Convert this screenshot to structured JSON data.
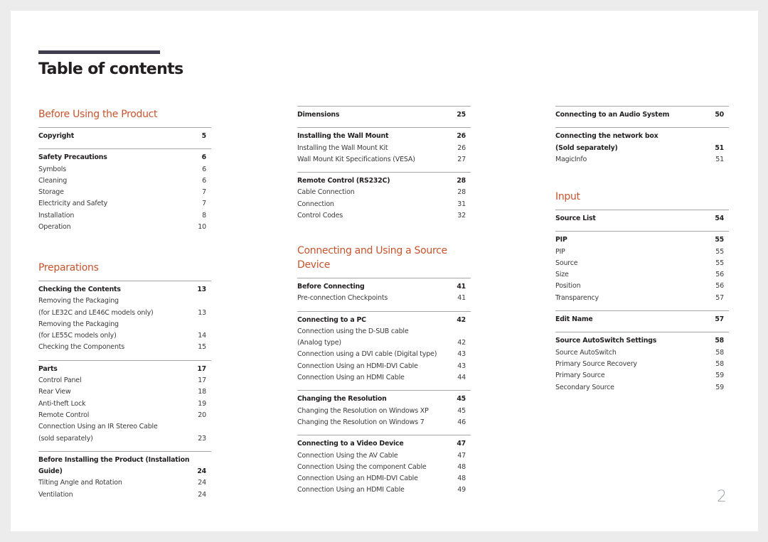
{
  "document": {
    "title": "Table of contents",
    "page_number": "2",
    "colors": {
      "accent": "#c8532d",
      "title_bar": "#403d4f",
      "text": "#3a3a3a"
    }
  },
  "chapters": [
    {
      "title": "Before Using the Product",
      "groups": [
        {
          "head": {
            "label": "Copyright",
            "page": "5"
          },
          "items": []
        },
        {
          "head": {
            "label": "Safety Precautions",
            "page": "6"
          },
          "items": [
            {
              "label": "Symbols",
              "page": "6"
            },
            {
              "label": "Cleaning",
              "page": "6"
            },
            {
              "label": "Storage",
              "page": "7"
            },
            {
              "label": "Electricity and Safety",
              "page": "7"
            },
            {
              "label": "Installation",
              "page": "8"
            },
            {
              "label": "Operation",
              "page": "10"
            }
          ]
        }
      ]
    },
    {
      "title": "Preparations",
      "groups": [
        {
          "head": {
            "label": "Checking the Contents",
            "page": "13"
          },
          "items": [
            {
              "label": "Removing the Packaging",
              "label2": "(for LE32C and LE46C models only)",
              "page": "13"
            },
            {
              "label": "Removing the Packaging",
              "label2": "(for LE55C models only)",
              "page": "14"
            },
            {
              "label": "Checking the Components",
              "page": "15"
            }
          ]
        },
        {
          "head": {
            "label": "Parts",
            "page": "17"
          },
          "items": [
            {
              "label": "Control Panel",
              "page": "17"
            },
            {
              "label": "Rear View",
              "page": "18"
            },
            {
              "label": "Anti-theft Lock",
              "page": "19"
            },
            {
              "label": "Remote Control",
              "page": "20"
            },
            {
              "label": "Connection Using an IR Stereo Cable",
              "label2": "(sold separately)",
              "page": "23"
            }
          ]
        },
        {
          "head": {
            "label": "Before Installing the Product (Installation",
            "label2": "Guide)",
            "page": "24"
          },
          "items": [
            {
              "label": "Tilting Angle and Rotation",
              "page": "24"
            },
            {
              "label": "Ventilation",
              "page": "24"
            }
          ]
        }
      ]
    },
    {
      "title": "",
      "groups": [
        {
          "head": {
            "label": "Dimensions",
            "page": "25"
          },
          "items": []
        },
        {
          "head": {
            "label": "Installing the Wall Mount",
            "page": "26"
          },
          "items": [
            {
              "label": "Installing the Wall Mount Kit",
              "page": "26"
            },
            {
              "label": "Wall Mount Kit Specifications (VESA)",
              "page": "27"
            }
          ]
        },
        {
          "head": {
            "label": "Remote Control (RS232C)",
            "page": "28"
          },
          "items": [
            {
              "label": "Cable Connection",
              "page": "28"
            },
            {
              "label": "Connection",
              "page": "31"
            },
            {
              "label": "Control Codes",
              "page": "32"
            }
          ]
        }
      ]
    },
    {
      "title": "Connecting and Using a Source Device",
      "groups": [
        {
          "head": {
            "label": "Before Connecting",
            "page": "41"
          },
          "items": [
            {
              "label": "Pre-connection Checkpoints",
              "page": "41"
            }
          ]
        },
        {
          "head": {
            "label": "Connecting to a PC",
            "page": "42"
          },
          "items": [
            {
              "label": "Connection using the D-SUB cable",
              "label2": "(Analog type)",
              "page": "42"
            },
            {
              "label": "Connection using a DVI cable (Digital type)",
              "page": "43"
            },
            {
              "label": "Connection Using an HDMI-DVI Cable",
              "page": "43"
            },
            {
              "label": "Connection Using an HDMI Cable",
              "page": "44"
            }
          ]
        },
        {
          "head": {
            "label": "Changing the Resolution",
            "page": "45"
          },
          "items": [
            {
              "label": "Changing the Resolution on Windows XP",
              "page": "45"
            },
            {
              "label": "Changing the Resolution on Windows 7",
              "page": "46"
            }
          ]
        },
        {
          "head": {
            "label": "Connecting to a Video Device",
            "page": "47"
          },
          "items": [
            {
              "label": "Connection Using the AV Cable",
              "page": "47"
            },
            {
              "label": "Connection Using the component Cable",
              "page": "48"
            },
            {
              "label": "Connection Using an HDMI-DVI Cable",
              "page": "48"
            },
            {
              "label": "Connection Using an HDMI Cable",
              "page": "49"
            }
          ]
        }
      ]
    },
    {
      "title": "",
      "groups": [
        {
          "head": {
            "label": "Connecting to an Audio System",
            "page": "50"
          },
          "items": []
        },
        {
          "head": {
            "label": "Connecting the network box",
            "label2": "(Sold separately)",
            "page": "51"
          },
          "items": [
            {
              "label": "MagicInfo",
              "page": "51"
            }
          ]
        }
      ]
    },
    {
      "title": "Input",
      "groups": [
        {
          "head": {
            "label": "Source List",
            "page": "54"
          },
          "items": []
        },
        {
          "head": {
            "label": "PIP",
            "page": "55"
          },
          "items": [
            {
              "label": "PIP",
              "page": "55"
            },
            {
              "label": "Source",
              "page": "55"
            },
            {
              "label": "Size",
              "page": "56"
            },
            {
              "label": "Position",
              "page": "56"
            },
            {
              "label": "Transparency",
              "page": "57"
            }
          ]
        },
        {
          "head": {
            "label": "Edit Name",
            "page": "57"
          },
          "items": []
        },
        {
          "head": {
            "label": "Source AutoSwitch Settings",
            "page": "58"
          },
          "items": [
            {
              "label": "Source AutoSwitch",
              "page": "58"
            },
            {
              "label": "Primary Source Recovery",
              "page": "58"
            },
            {
              "label": "Primary Source",
              "page": "59"
            },
            {
              "label": "Secondary Source",
              "page": "59"
            }
          ]
        }
      ]
    }
  ]
}
